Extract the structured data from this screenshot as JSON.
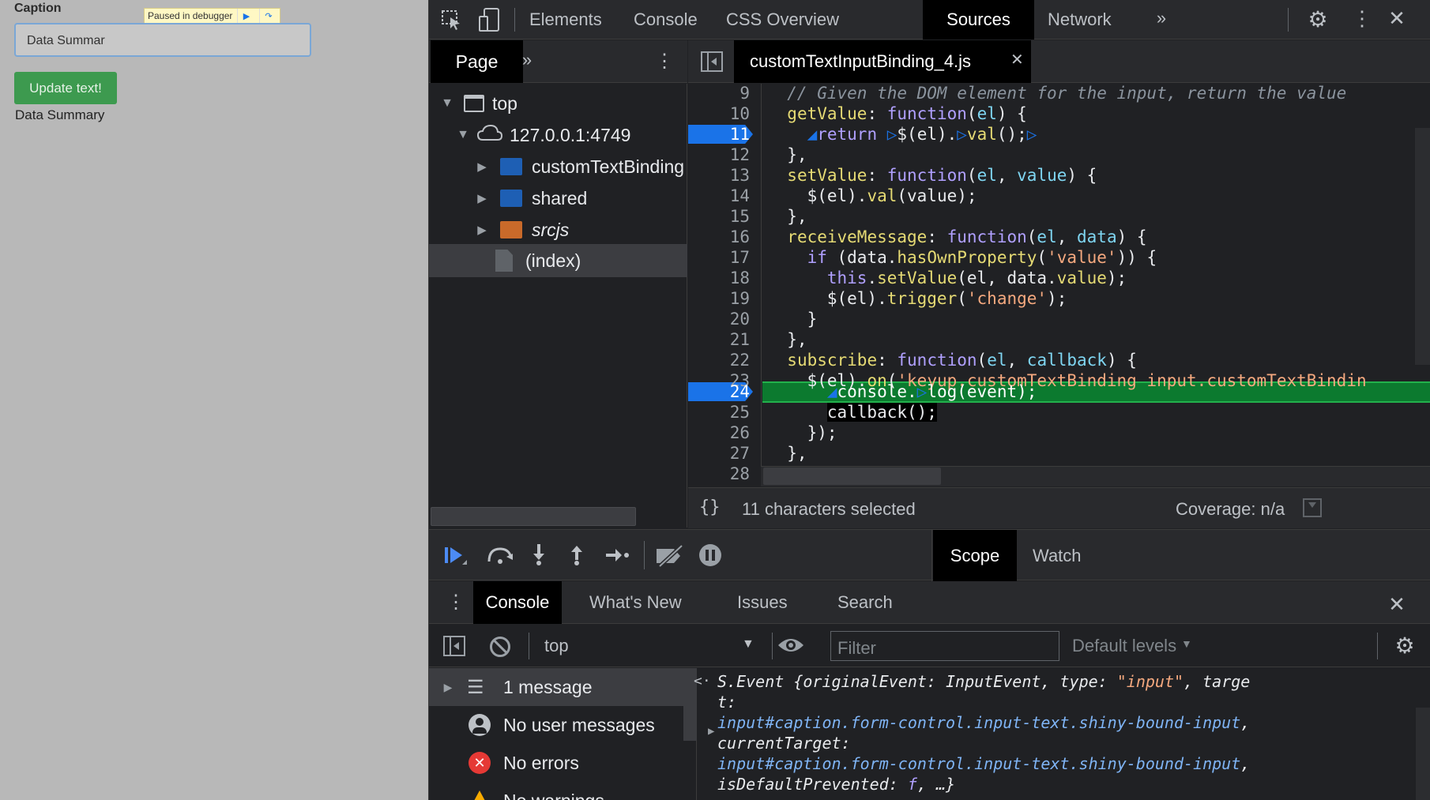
{
  "app": {
    "caption_label": "Caption",
    "paused_banner": "Paused in debugger",
    "input_value": "Data Summar",
    "update_button": "Update text!",
    "output_text": "Data Summary"
  },
  "devtools": {
    "main_tabs": [
      "Elements",
      "Console",
      "CSS Overview",
      "Sources",
      "Network"
    ],
    "active_main_tab": "Sources",
    "navigator": {
      "tab": "Page",
      "tree": [
        {
          "label": "top",
          "type": "frame"
        },
        {
          "label": "127.0.0.1:4749",
          "type": "origin"
        },
        {
          "label": "customTextBinding",
          "type": "folder",
          "color": "#1e5fb4"
        },
        {
          "label": "shared",
          "type": "folder",
          "color": "#1e5fb4"
        },
        {
          "label": "srcjs",
          "type": "folder",
          "color": "#c96a2a"
        },
        {
          "label": "(index)",
          "type": "file"
        }
      ]
    },
    "editor": {
      "file_tab": "customTextInputBinding_4.js",
      "line_numbers": [
        "9",
        "10",
        "11",
        "12",
        "13",
        "14",
        "15",
        "16",
        "17",
        "18",
        "19",
        "20",
        "21",
        "22",
        "23",
        "24",
        "25",
        "26",
        "27",
        "28"
      ],
      "breakpoint_lines": [
        "11",
        "24"
      ],
      "status_selected": "11 characters selected",
      "coverage": "Coverage: n/a"
    },
    "debugger": {
      "sidebar_tabs": [
        "Scope",
        "Watch"
      ],
      "active_sidebar_tab": "Scope"
    },
    "drawer": {
      "tabs": [
        "Console",
        "What's New",
        "Issues",
        "Search"
      ],
      "active_tab": "Console",
      "context": "top",
      "filter_placeholder": "Filter",
      "levels": "Default levels",
      "sidebar": [
        {
          "label": "1 message",
          "icon": "list-icon"
        },
        {
          "label": "No user messages",
          "icon": "user-icon"
        },
        {
          "label": "No errors",
          "icon": "error-icon"
        },
        {
          "label": "No warnings",
          "icon": "warning-icon"
        }
      ]
    }
  }
}
